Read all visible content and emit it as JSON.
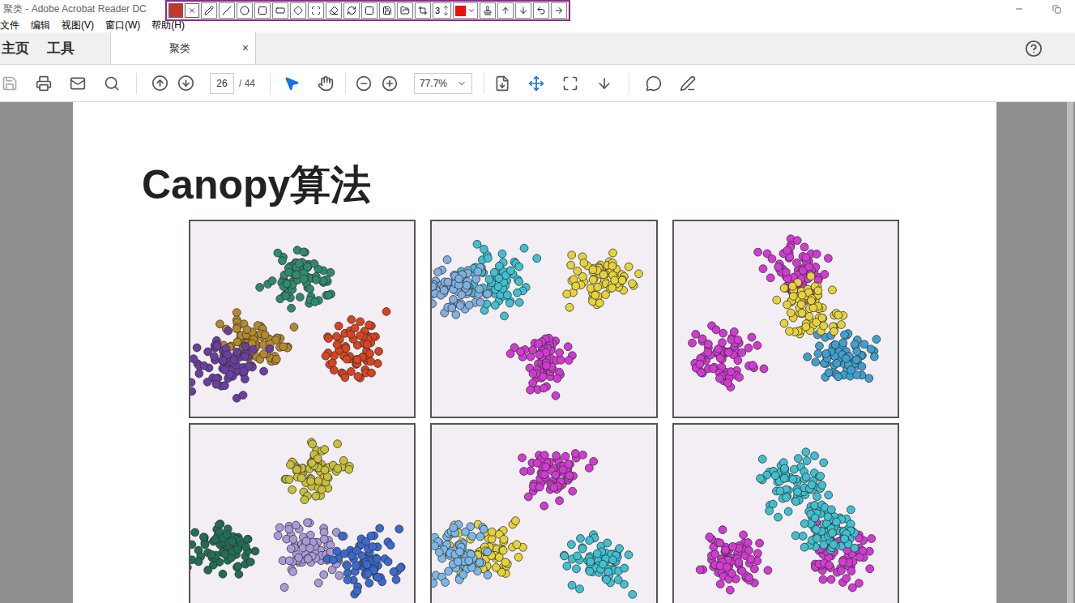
{
  "window": {
    "title": "聚类 - Adobe Acrobat Reader DC"
  },
  "annotation_toolbar": {
    "line_width": "3",
    "color": "#e8100d"
  },
  "menu": [
    "文件",
    "编辑",
    "视图(V)",
    "窗口(W)",
    "帮助(H)"
  ],
  "nav_tabs": [
    {
      "label": "主页",
      "selected": false
    },
    {
      "label": "工具",
      "selected": false
    }
  ],
  "document_tab": {
    "label": "聚类",
    "close": "×",
    "selected": true
  },
  "help": "?",
  "toolbar": {
    "page": "26",
    "total": "/ 44",
    "zoom": "77.7%",
    "select_tool_selected": true
  },
  "document": {
    "title": "Canopy算法",
    "figures": [
      {
        "clusters": [
          {
            "color": "#2e8b6e",
            "x": 48,
            "y": 28
          },
          {
            "color": "#b5892a",
            "x": 28,
            "y": 62
          },
          {
            "color": "#d9441f",
            "x": 72,
            "y": 65
          },
          {
            "color": "#6a3fa0",
            "x": 16,
            "y": 72
          }
        ]
      },
      {
        "clusters": [
          {
            "color": "#3ec0d0",
            "x": 30,
            "y": 30
          },
          {
            "color": "#e6d23a",
            "x": 75,
            "y": 30
          },
          {
            "color": "#d23ad2",
            "x": 50,
            "y": 72
          },
          {
            "color": "#7fb0e0",
            "x": 10,
            "y": 35
          }
        ]
      },
      {
        "clusters": [
          {
            "color": "#d23ad2",
            "x": 55,
            "y": 25
          },
          {
            "color": "#d23ad2",
            "x": 22,
            "y": 70
          },
          {
            "color": "#3ea0d0",
            "x": 75,
            "y": 70
          },
          {
            "color": "#e6d23a",
            "x": 60,
            "y": 45
          }
        ]
      },
      {
        "clusters": [
          {
            "color": "#c8c03a",
            "x": 55,
            "y": 25
          },
          {
            "color": "#1f6e55",
            "x": 15,
            "y": 65
          },
          {
            "color": "#a89ad8",
            "x": 55,
            "y": 65
          },
          {
            "color": "#3a6ad0",
            "x": 80,
            "y": 70
          }
        ]
      },
      {
        "clusters": [
          {
            "color": "#d23ad2",
            "x": 55,
            "y": 25
          },
          {
            "color": "#e6d23a",
            "x": 25,
            "y": 65
          },
          {
            "color": "#3ec0d0",
            "x": 75,
            "y": 70
          },
          {
            "color": "#7ab8e8",
            "x": 12,
            "y": 65
          }
        ]
      },
      {
        "clusters": [
          {
            "color": "#3ec0d0",
            "x": 55,
            "y": 30
          },
          {
            "color": "#d23ad2",
            "x": 25,
            "y": 70
          },
          {
            "color": "#d23ad2",
            "x": 75,
            "y": 68
          },
          {
            "color": "#3ec0d0",
            "x": 70,
            "y": 52
          }
        ]
      }
    ]
  }
}
